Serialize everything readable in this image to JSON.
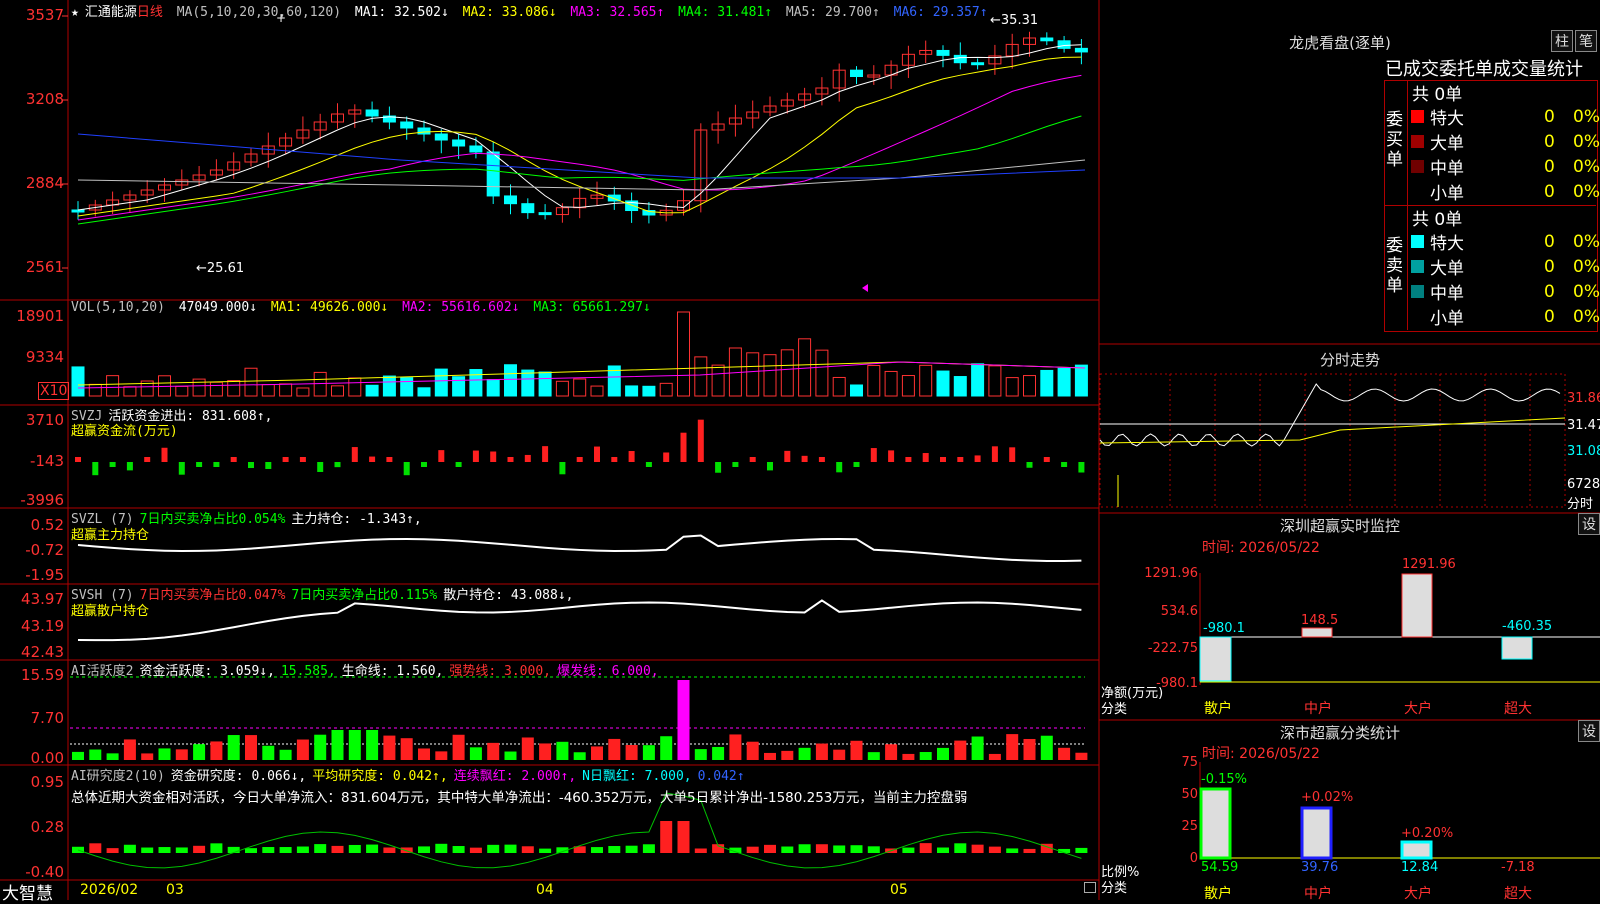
{
  "stock": {
    "name": "汇通能源",
    "period": "日线"
  },
  "main_legend": {
    "ma": "MA(5,10,20,30,60,120)",
    "ma1": "MA1: 32.502↓",
    "ma2": "MA2: 33.086↓",
    "ma3": "MA3: 32.565↑",
    "ma4": "MA4: 31.481↑",
    "ma5": "MA5: 29.700↑",
    "ma6": "MA6: 29.357↑"
  },
  "main_y": [
    "3537",
    "3208",
    "2884",
    "2561"
  ],
  "price_marks": {
    "high": "35.31",
    "low": "25.61"
  },
  "vol_legend": {
    "name": "VOL(5,10,20)",
    "v": "47049.000↓",
    "ma1": "MA1: 49626.000↓",
    "ma2": "MA2: 55616.602↓",
    "ma3": "MA3: 65661.297↓"
  },
  "vol_y": [
    "18901",
    "9334"
  ],
  "vol_unit": "X10",
  "svzj": {
    "name": "SVZJ",
    "text": "活跃资金进出: 831.608↑,",
    "sub": "超赢资金流(万元)",
    "y": [
      "3710",
      "-143",
      "-3996"
    ]
  },
  "svzl": {
    "name": "SVZL (7)",
    "text1": "7日内买卖净占比0.054%",
    "text2": "主力持仓: -1.343↑,",
    "sub": "超赢主力持仓",
    "y": [
      "0.52",
      "-0.72",
      "-1.95"
    ]
  },
  "svsh": {
    "name": "SVSH (7)",
    "text1": "7日内买卖净占比0.047%",
    "text2": "7日内买卖净占比0.115%",
    "text3": "散户持仓: 43.088↓,",
    "sub": "超赢散户持仓",
    "y": [
      "43.97",
      "43.19",
      "42.43"
    ]
  },
  "ai1": {
    "name": "AI活跃度2",
    "t1": "资金活跃度: 3.059↓,",
    "t2": "15.585,",
    "t3": "生命线: 1.560,",
    "t4": "强势线: 3.000,",
    "t5": "爆发线: 6.000,",
    "y": [
      "15.59",
      "7.70",
      "0.00"
    ]
  },
  "ai2": {
    "name": "AI研究度2(10)",
    "t1": "资金研究度: 0.066↓,",
    "t2": "平均研究度: 0.042↑,",
    "t3": "连续飘红: 2.000↑,",
    "t4": "N日飘红: 7.000,",
    "t5": "0.042↑",
    "summary": "总体近期大资金相对活跃，今日大单净流入：831.604万元，其中特大单净流出：-460.352万元，大单5日累计净出-1580.253万元，当前主力控盘弱",
    "y": [
      "0.95",
      "0.28",
      "-0.40"
    ]
  },
  "bottom": {
    "brand": "大智慧",
    "dates": [
      "2026/02",
      "03",
      "04",
      "05"
    ]
  },
  "dragon": {
    "title": "龙虎看盘(逐单)",
    "btn1": "柱",
    "btn2": "笔",
    "header": "已成交委托单成交量统计",
    "buy_label": "委买单",
    "sell_label": "委卖单",
    "buy_total": "共 0单",
    "sell_total": "共 0单",
    "buy_rows": [
      {
        "label": "特大",
        "v": "0",
        "p": "0%"
      },
      {
        "label": "大单",
        "v": "0",
        "p": "0%"
      },
      {
        "label": "中单",
        "v": "0",
        "p": "0%"
      },
      {
        "label": "小单",
        "v": "0",
        "p": "0%"
      }
    ],
    "sell_rows": [
      {
        "label": "特大",
        "v": "0",
        "p": "0%"
      },
      {
        "label": "大单",
        "v": "0",
        "p": "0%"
      },
      {
        "label": "中单",
        "v": "0",
        "p": "0%"
      },
      {
        "label": "小单",
        "v": "0",
        "p": "0%"
      }
    ]
  },
  "intraday": {
    "title": "分时走势",
    "y": [
      "31.86",
      "31.47",
      "31.08"
    ],
    "vol": "6728",
    "unit": "分时"
  },
  "sz_monitor": {
    "title": "深圳超赢实时监控",
    "btn": "设",
    "time": "时间: 2026/05/22",
    "y": [
      "1291.96",
      "534.6",
      "-222.75",
      "-980.1"
    ],
    "ylabel": "净额(万元)",
    "xlabel": "分类",
    "cats": [
      "散户",
      "中户",
      "大户",
      "超大"
    ],
    "values": [
      "-980.1",
      "148.5",
      "1291.96",
      "-460.35"
    ]
  },
  "sz_class": {
    "title": "深市超赢分类统计",
    "btn": "设",
    "time": "时间: 2026/05/22",
    "y": [
      "75",
      "50",
      "25",
      "0"
    ],
    "ylabel": "比例%",
    "xlabel": "分类",
    "cats": [
      "散户",
      "中户",
      "大户",
      "超大"
    ],
    "top": [
      "-0.15%",
      "+0.02%",
      "+0.20%",
      ""
    ],
    "bottom": [
      "54.59",
      "39.76",
      "12.84",
      "-7.18"
    ]
  },
  "colors": {
    "up": "#ff3232",
    "down": "#00ffff",
    "grid": "#b00000"
  }
}
